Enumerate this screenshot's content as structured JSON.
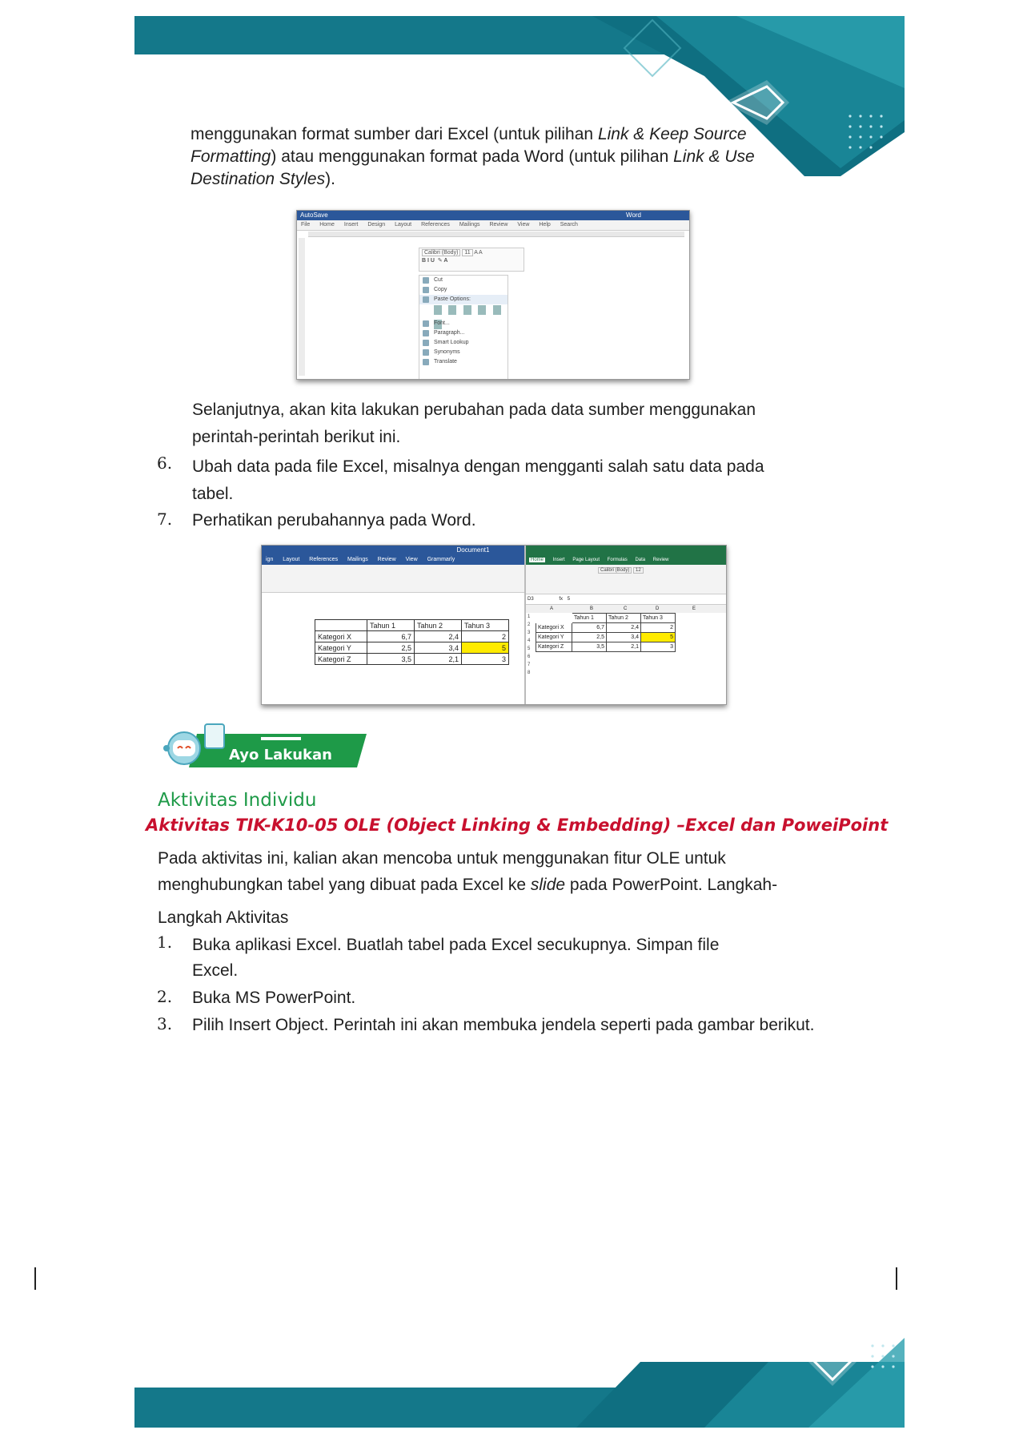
{
  "continuation": {
    "line1_a": "menggunakan format sumber dari Excel (untuk pilihan ",
    "line1_b": "Link & Keep Source",
    "line2_a": "Formatting",
    "line2_b": ") atau menggunakan format pada Word (untuk pilihan ",
    "line2_c": "Link & Use",
    "line3_a": "Destination Styles",
    "line3_b": ")."
  },
  "word_shot": {
    "title_left": "AutoSave",
    "title_right": "Word",
    "tabs": [
      "File",
      "Home",
      "Insert",
      "Design",
      "Layout",
      "References",
      "Mailings",
      "Review",
      "View",
      "Help",
      "Search"
    ],
    "font_box": "Calibri (Body)",
    "font_size": "11",
    "menu_items": [
      "Cut",
      "Copy",
      "Paste Options:",
      "Font...",
      "Paragraph...",
      "Smart Lookup",
      "Synonyms",
      "Translate"
    ]
  },
  "para_next": {
    "line1": "Selanjutnya, akan kita lakukan perubahan pada data sumber menggunakan",
    "line2": "perintah-perintah berikut ini."
  },
  "steps_a": [
    {
      "num": "6.",
      "line1": "Ubah  data  pada  file  Excel, misalnya  dengan  mengganti  salah  satu  data pada",
      "line2": "tabel."
    },
    {
      "num": "7.",
      "line1": "Perhatikan perubahannya pada Word."
    }
  ],
  "compare_shot": {
    "word_title": "Document1",
    "word_tabs": [
      "ign",
      "Layout",
      "References",
      "Mailings",
      "Review",
      "View",
      "Grammarly"
    ],
    "excel_tabs": [
      "Home",
      "Insert",
      "Page Layout",
      "Formulas",
      "Data",
      "Review"
    ],
    "excel_font": "Calibri (Body)",
    "excel_size": "12",
    "cell_ref": "D3",
    "formula": "5",
    "col_letters": [
      "A",
      "B",
      "C",
      "D",
      "E"
    ],
    "row_numbers": [
      "1",
      "2",
      "3",
      "4",
      "5",
      "6",
      "7",
      "8"
    ],
    "headers": [
      "",
      "Tahun 1",
      "Tahun 2",
      "Tahun 3"
    ],
    "rows": [
      [
        "Kategori X",
        "6,7",
        "2,4",
        "2"
      ],
      [
        "Kategori Y",
        "2,5",
        "3,4",
        "5"
      ],
      [
        "Kategori Z",
        "3,5",
        "2,1",
        "3"
      ]
    ],
    "colors": {
      "highlight": "#ffeb00",
      "excel_green": "#217346",
      "word_blue": "#2b579a"
    }
  },
  "ayo": {
    "label": "Ayo Lakukan"
  },
  "activity": {
    "heading": "Aktivitas Individu",
    "title": "Aktivitas TIK-K10-05 OLE (Object Linking & Embedding) –Excel dan PoweiPoint",
    "intro_line1": "Pada aktivitas ini, kalian akan mencoba untuk menggunakan fitur OLE untuk",
    "intro_line2_a": "menghubungkan tabel yang dibuat pada Excel ke ",
    "intro_line2_b": "slide",
    "intro_line2_c": " pada PowerPoint. Langkah-",
    "intro_line3": "Langkah Aktivitas"
  },
  "steps_b": [
    {
      "num": "1.",
      "line1": "Buka  aplikasi  Excel. Buatlah  tabel  pada  Excel  secukupnya. Simpan  file",
      "line2": "Excel."
    },
    {
      "num": "2.",
      "line1": "Buka MS PowerPoint."
    },
    {
      "num": "3.",
      "line1": "Pilih Insert Object. Perintah ini akan membuka jendela seperti pada gambar berikut."
    }
  ],
  "theme_colors": {
    "teal": "#14788a",
    "green": "#1e9a48",
    "red": "#c8102e"
  }
}
